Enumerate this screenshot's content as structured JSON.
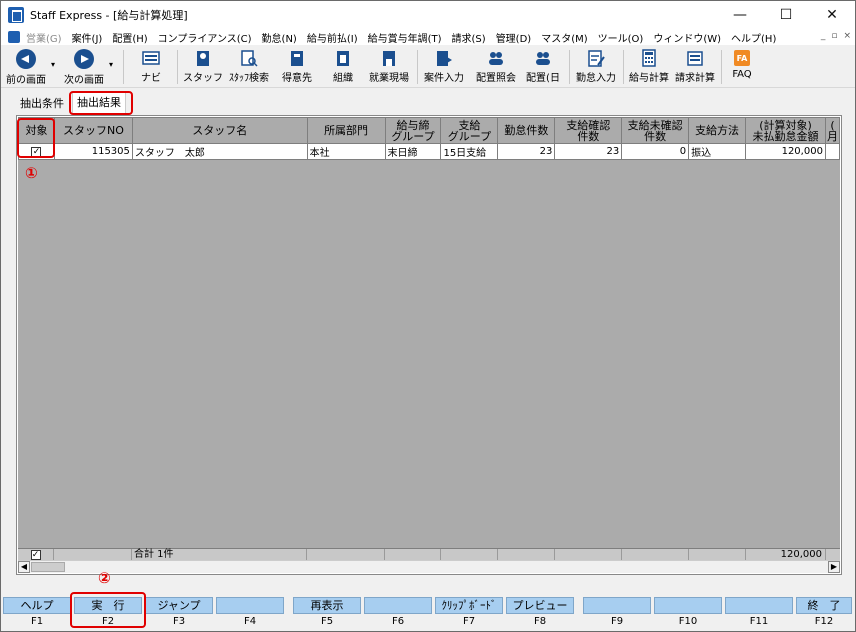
{
  "window": {
    "title": "Staff Express - [給与計算処理]",
    "minimize": "—",
    "maximize": "☐",
    "close": "✕"
  },
  "menu": {
    "items": [
      {
        "label": "営業(G)",
        "disabled": true
      },
      {
        "label": "案件(J)"
      },
      {
        "label": "配置(H)"
      },
      {
        "label": "コンプライアンス(C)"
      },
      {
        "label": "勤怠(N)"
      },
      {
        "label": "給与前払(I)"
      },
      {
        "label": "給与賞与年調(T)"
      },
      {
        "label": "請求(S)"
      },
      {
        "label": "管理(D)"
      },
      {
        "label": "マスタ(M)"
      },
      {
        "label": "ツール(O)"
      },
      {
        "label": "ウィンドウ(W)"
      },
      {
        "label": "ヘルプ(H)"
      }
    ],
    "mdi": [
      "_",
      "▫",
      "×"
    ]
  },
  "toolbar": {
    "prev": "前の画面",
    "next": "次の画面",
    "dropdown": "▾",
    "buttons": [
      "ナビ",
      "スタッフ",
      "ｽﾀｯﾌ検索",
      "得意先",
      "組織",
      "就業現場",
      "案件入力",
      "配置照会",
      "配置(日",
      "勤怠入力",
      "給与計算",
      "請求計算",
      "FAQ"
    ]
  },
  "tabs": {
    "conditions": "抽出条件",
    "results": "抽出結果"
  },
  "grid": {
    "headers": [
      "対象",
      "スタッフNO",
      "スタッフ名",
      "所属部門",
      "給与締\nグループ",
      "支給\nグループ",
      "勤怠件数",
      "支給確認\n件数",
      "支給未確認\n件数",
      "支給方法",
      "(計算対象)\n未払勤怠金額",
      "(\n月"
    ],
    "rows": [
      [
        "✓",
        "115305",
        "スタッフ　太郎",
        "本社",
        "末日締",
        "15日支給",
        "23",
        "23",
        "0",
        "振込",
        "120,000",
        ""
      ]
    ],
    "footer": {
      "check": "✓",
      "total": "合計 1件",
      "amount": "120,000"
    }
  },
  "scroll": {
    "left": "◀",
    "right": "▶"
  },
  "fkeys": [
    {
      "label": "ヘルプ",
      "key": "F1"
    },
    {
      "label": "実　行",
      "key": "F2"
    },
    {
      "label": "ジャンプ",
      "key": "F3"
    },
    {
      "label": "",
      "key": "F4"
    },
    {
      "label": "再表示",
      "key": "F5"
    },
    {
      "label": "",
      "key": "F6"
    },
    {
      "label": "ｸﾘｯﾌﾟﾎﾞｰﾄﾞ",
      "key": "F7"
    },
    {
      "label": "プレビュー",
      "key": "F8"
    },
    {
      "label": "",
      "key": "F9"
    },
    {
      "label": "",
      "key": "F10"
    },
    {
      "label": "",
      "key": "F11"
    },
    {
      "label": "終　了",
      "key": "F12"
    }
  ],
  "annotations": {
    "one": "①",
    "two": "②"
  },
  "colors": {
    "fkey": "#a7cef0",
    "grid_bg": "#ababab",
    "highlight": "#e00000"
  }
}
